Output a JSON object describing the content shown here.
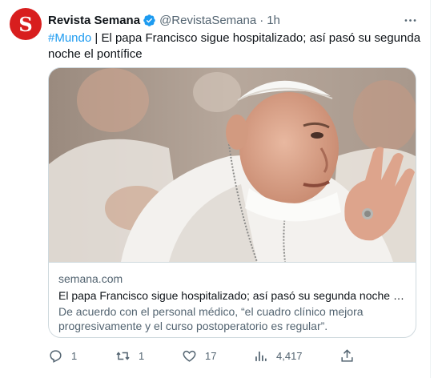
{
  "author": {
    "avatar_letter": "S",
    "name": "Revista Semana",
    "handle": "@RevistaSemana",
    "separator": "·",
    "time": "1h"
  },
  "tweet": {
    "hashtag": "#Mundo",
    "text": " | El papa Francisco sigue hospitalizado; así pasó su segunda noche el pontífice"
  },
  "card": {
    "domain": "semana.com",
    "title": "El papa Francisco sigue hospitalizado; así pasó su segunda noche el ...",
    "description": "De acuerdo con el personal médico, “el cuadro clínico mejora progresivamente y el curso postoperatorio es regular”."
  },
  "metrics": {
    "replies": "1",
    "retweets": "1",
    "likes": "17",
    "views": "4,417"
  },
  "icons": [
    "verified-badge-icon",
    "more-icon",
    "reply-icon",
    "retweet-icon",
    "like-icon",
    "views-icon",
    "share-icon"
  ],
  "colors": {
    "accent": "#1d9bf0",
    "avatar_bg": "#d81e1e",
    "muted": "#536471"
  }
}
